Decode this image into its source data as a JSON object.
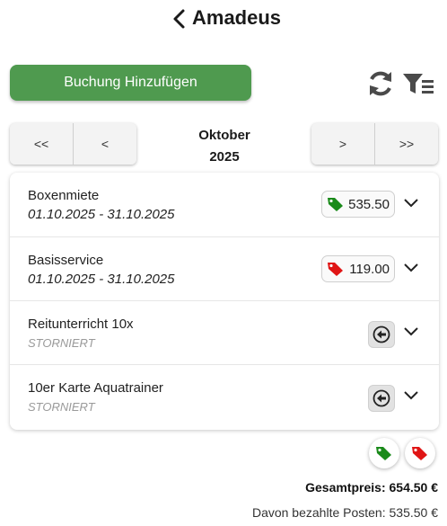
{
  "header": {
    "title": "Amadeus",
    "back_icon": "chevron-left-icon"
  },
  "toolbar": {
    "add_label": "Buchung Hinzufügen",
    "refresh_icon": "refresh-icon",
    "filter_icon": "filter-icon"
  },
  "month_nav": {
    "first_label": "<<",
    "prev_label": "<",
    "next_label": ">",
    "last_label": ">>",
    "month": "Oktober",
    "year": "2025"
  },
  "bookings": [
    {
      "name": "Boxenmiete",
      "sub": "01.10.2025 - 31.10.2025",
      "amount": "535.50",
      "tag_color": "#1a8a1a",
      "status": "paid"
    },
    {
      "name": "Basisservice",
      "sub": "01.10.2025 - 31.10.2025",
      "amount": "119.00",
      "tag_color": "#e01515",
      "status": "unpaid"
    },
    {
      "name": "Reitunterricht 10x",
      "sub": "STORNIERT",
      "status": "cancelled"
    },
    {
      "name": "10er Karte Aquatrainer",
      "sub": "STORNIERT",
      "status": "cancelled"
    }
  ],
  "colors": {
    "accent": "#4f9a4f",
    "paid": "#1a8a1a",
    "unpaid": "#e01515"
  },
  "summary": {
    "total": "Gesamtpreis: 654.50 €",
    "paid": "Davon bezahlte Posten: 535.50 €"
  }
}
